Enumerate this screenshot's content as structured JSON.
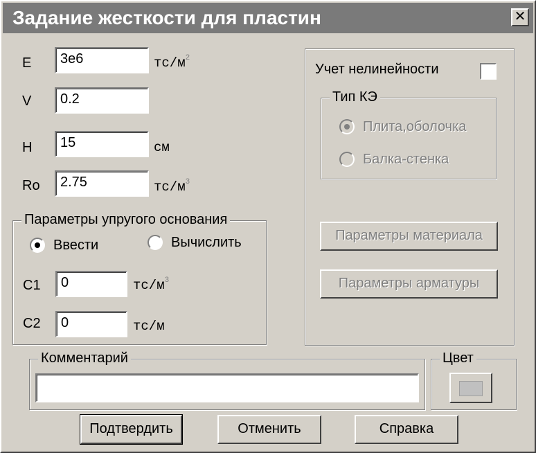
{
  "window": {
    "title": "Задание жесткости для пластин",
    "close_label": "✕"
  },
  "fields": {
    "E": {
      "label": "E",
      "value": "3e6",
      "unit": "тс/м",
      "unit_sup": "2"
    },
    "V": {
      "label": "V",
      "value": "0.2"
    },
    "H": {
      "label": "H",
      "value": "15",
      "unit": "см"
    },
    "Ro": {
      "label": "Ro",
      "value": "2.75",
      "unit": "тс/м",
      "unit_sup": "3"
    }
  },
  "foundation": {
    "title": "Параметры упругого основания",
    "radio_enter": "Ввести",
    "radio_calc": "Вычислить",
    "selected": "enter",
    "C1": {
      "label": "C1",
      "value": "0",
      "unit": "тс/м",
      "unit_sup": "3"
    },
    "C2": {
      "label": "C2",
      "value": "0",
      "unit": "тс/м"
    }
  },
  "nonlinear": {
    "label": "Учет нелинейности",
    "checked": false,
    "fe_type": {
      "title": "Тип КЭ",
      "option_plate": "Плита,оболочка",
      "option_beam": "Балка-стенка",
      "selected": "plate"
    },
    "material_button": "Параметры материала",
    "rebar_button": "Параметры арматуры"
  },
  "comment": {
    "title": "Комментарий",
    "value": ""
  },
  "color": {
    "title": "Цвет",
    "swatch": "#c0c0c0"
  },
  "buttons": {
    "confirm": "Подтвердить",
    "cancel": "Отменить",
    "help": "Справка"
  }
}
